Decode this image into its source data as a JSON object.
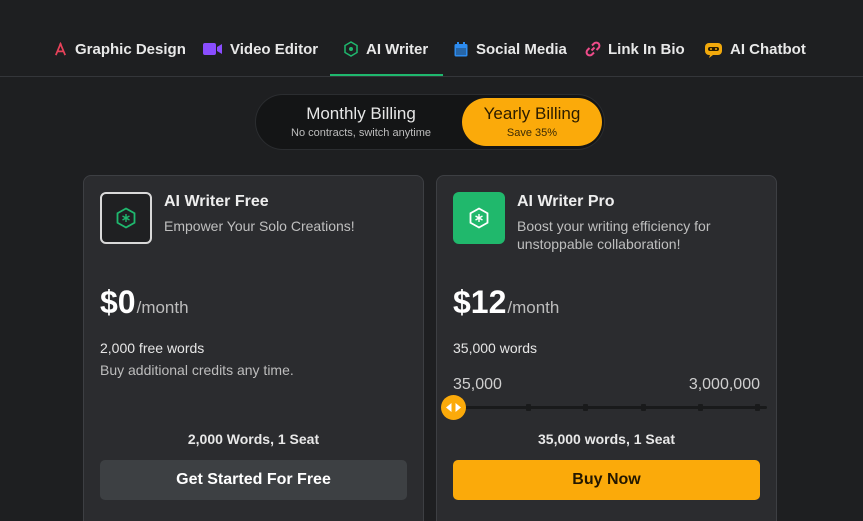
{
  "nav": {
    "tabs": [
      {
        "label": "Graphic Design",
        "icon": "graphic-design-icon"
      },
      {
        "label": "Video Editor",
        "icon": "video-camera-icon"
      },
      {
        "label": "AI Writer",
        "icon": "ai-writer-icon"
      },
      {
        "label": "Social Media",
        "icon": "calendar-icon"
      },
      {
        "label": "Link In Bio",
        "icon": "link-icon"
      },
      {
        "label": "AI Chatbot",
        "icon": "chatbot-icon"
      }
    ],
    "active_tab": "AI Writer"
  },
  "billing": {
    "monthly_title": "Monthly Billing",
    "monthly_sub": "No contracts, switch anytime",
    "yearly_title": "Yearly Billing",
    "yearly_sub": "Save 35%",
    "selected": "yearly"
  },
  "plans": {
    "free": {
      "name": "AI Writer Free",
      "tagline": "Empower Your Solo Creations!",
      "price": "$0",
      "period": "/month",
      "words": "2,000 free words",
      "extra": "Buy additional credits any time.",
      "summary": "2,000 Words, 1 Seat",
      "cta": "Get Started For Free"
    },
    "pro": {
      "name": "AI Writer Pro",
      "tagline": "Boost your writing efficiency for unstoppable collaboration!",
      "price": "$12",
      "period": "/month",
      "words": "35,000 words",
      "range_min": "35,000",
      "range_max": "3,000,000",
      "slider_value": 35000,
      "slider_steps": 6,
      "summary": "35,000 words, 1 Seat",
      "cta": "Buy Now"
    }
  },
  "colors": {
    "accent_yellow": "#fbaa0a",
    "brand_green": "#20b86c",
    "background": "#1e1f21",
    "card": "#2b2c2f"
  }
}
